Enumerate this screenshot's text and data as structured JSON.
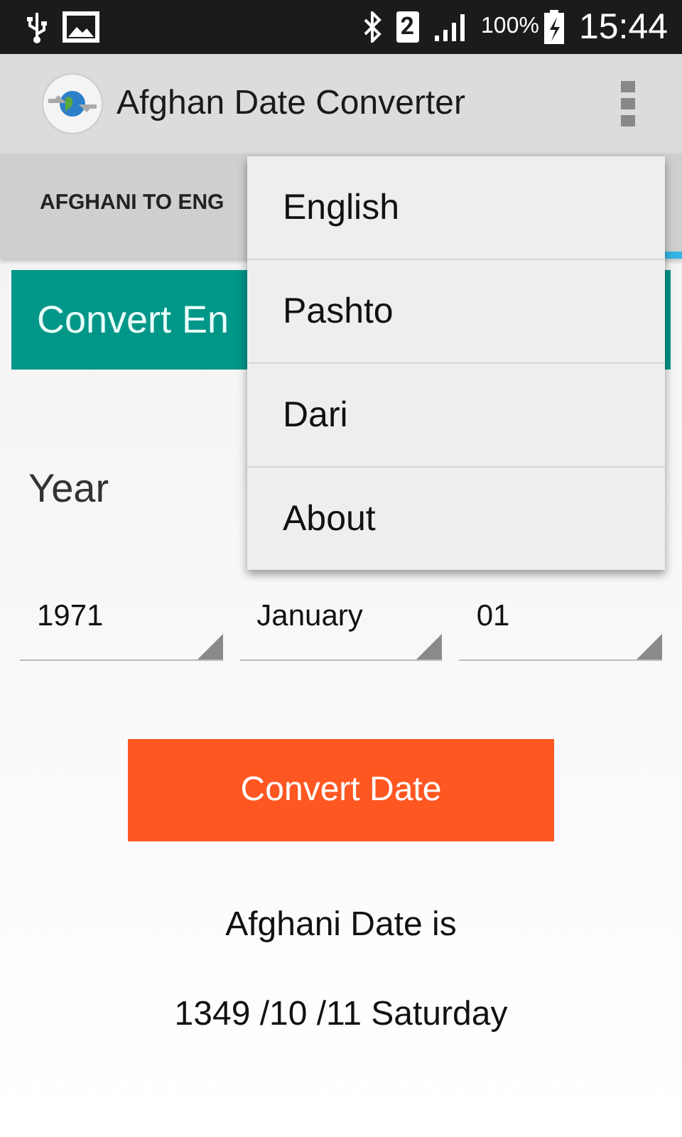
{
  "status_bar": {
    "sim": "2",
    "battery": "100%",
    "time": "15:44"
  },
  "app_bar": {
    "title": "Afghan Date Converter"
  },
  "tabs": [
    {
      "label": "AFGHANI TO ENG",
      "selected": false
    },
    {
      "selected": true
    }
  ],
  "section_header": "Convert En",
  "year_label": "Year",
  "spinners": [
    {
      "value": "1971"
    },
    {
      "value": "January"
    },
    {
      "value": "01"
    }
  ],
  "convert_button": "Convert Date",
  "result_label": "Afghani Date is",
  "result_value": "1349 /10 /11 Saturday",
  "menu": [
    {
      "label": "English"
    },
    {
      "label": "Pashto"
    },
    {
      "label": "Dari"
    },
    {
      "label": "About"
    }
  ]
}
